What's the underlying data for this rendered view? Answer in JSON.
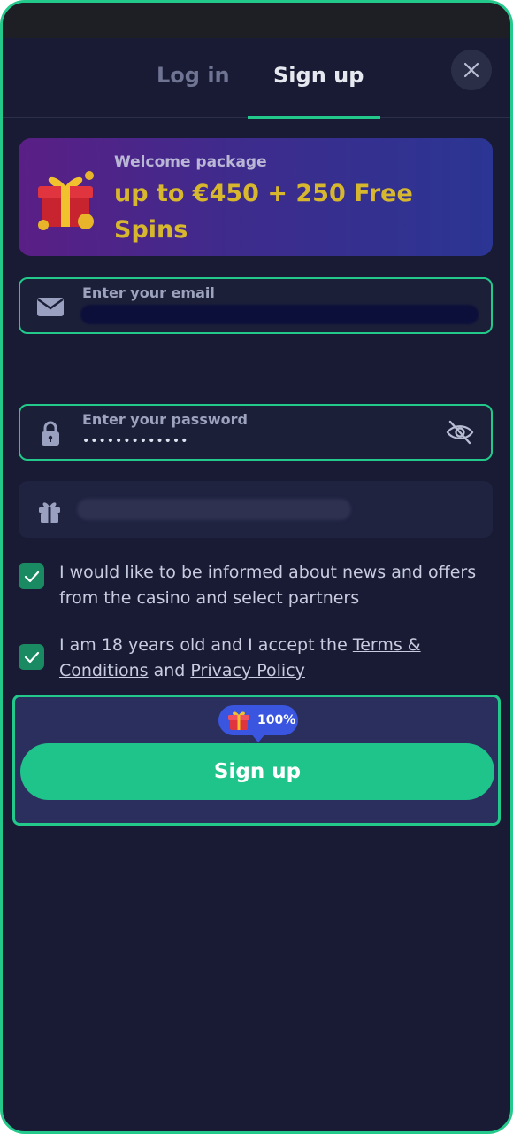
{
  "colors": {
    "accent": "#22c98a",
    "background": "#181b33",
    "promo_text": "#d7b72e",
    "badge": "#3a56e0"
  },
  "tabs": [
    {
      "label": "Log in",
      "active": false
    },
    {
      "label": "Sign up",
      "active": true
    }
  ],
  "close_icon": "close-icon",
  "promo": {
    "label": "Welcome package",
    "title": "up to €450 + 250 Free Spins",
    "icon": "gift-box-icon"
  },
  "email_field": {
    "label": "Enter your email",
    "icon": "envelope-icon"
  },
  "password_field": {
    "label": "Enter your password",
    "value": "•••••••••••••",
    "icon": "lock-icon",
    "toggle_icon": "eye-off-icon"
  },
  "promo_code_field": {
    "icon": "gift-icon"
  },
  "checkboxes": [
    {
      "checked": true,
      "text": "I would like to be informed about news and offers from the casino and select partners"
    },
    {
      "checked": true,
      "text_before": "I am 18 years old and I accept the ",
      "terms_link": "Terms & Conditions",
      "text_middle": " and ",
      "privacy_link": "Privacy Policy"
    }
  ],
  "cta": {
    "badge_text": "100%",
    "badge_icon": "gift-icon",
    "button_label": "Sign up"
  }
}
